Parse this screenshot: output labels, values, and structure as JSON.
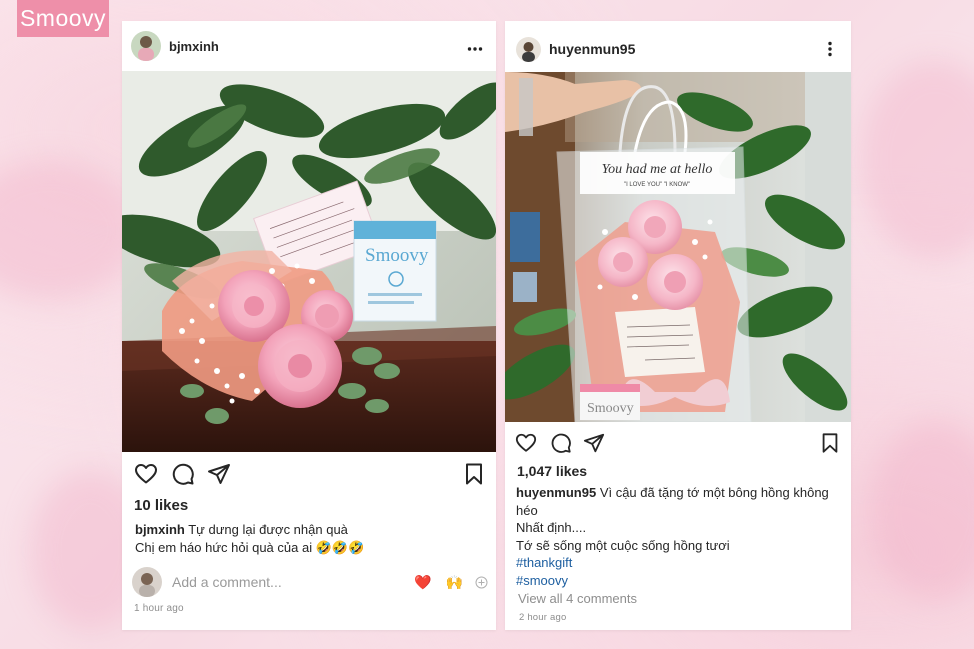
{
  "brand": {
    "logo_text": "Smoovy",
    "color": "#ee8fa9"
  },
  "posts": [
    {
      "username": "bjmxinh",
      "more_icon": "more-horizontal-icon",
      "likes": "10 likes",
      "caption_user": "bjmxinh",
      "caption_lines": [
        "Tự dưng lại được nhận quà",
        "Chị em háo hức hỏi quà của ai 🤣🤣🤣"
      ],
      "comment_placeholder": "Add a comment...",
      "quick_emojis": [
        "❤️",
        "🙌"
      ],
      "time": "1 hour ago",
      "photo": {
        "card_note": "Cảm ơn vì đã luôn là chính mình",
        "product_text": "Smoovy"
      }
    },
    {
      "username": "huyenmun95",
      "more_icon": "more-vertical-icon",
      "likes": "1,047 likes",
      "caption_user": "huyenmun95",
      "caption_lines": [
        "Vì cậu đã tặng tớ một bông hồng không héo",
        "Nhất định....",
        "Tớ sẽ sống một cuộc sống hồng tươi"
      ],
      "hashtags": [
        "#thankgift",
        "#smoovy"
      ],
      "view_comments": "View all 4 comments",
      "time": "2 hour ago",
      "photo": {
        "bag_script": "You had me at hello",
        "bag_sub": "\"I LOVE YOU\" \"I KNOW\"",
        "product_text": "Smoovy"
      }
    }
  ],
  "colors": {
    "accent": "#ee8fa9",
    "hashtag": "#1e5fa0",
    "muted": "#8e8e8e"
  }
}
